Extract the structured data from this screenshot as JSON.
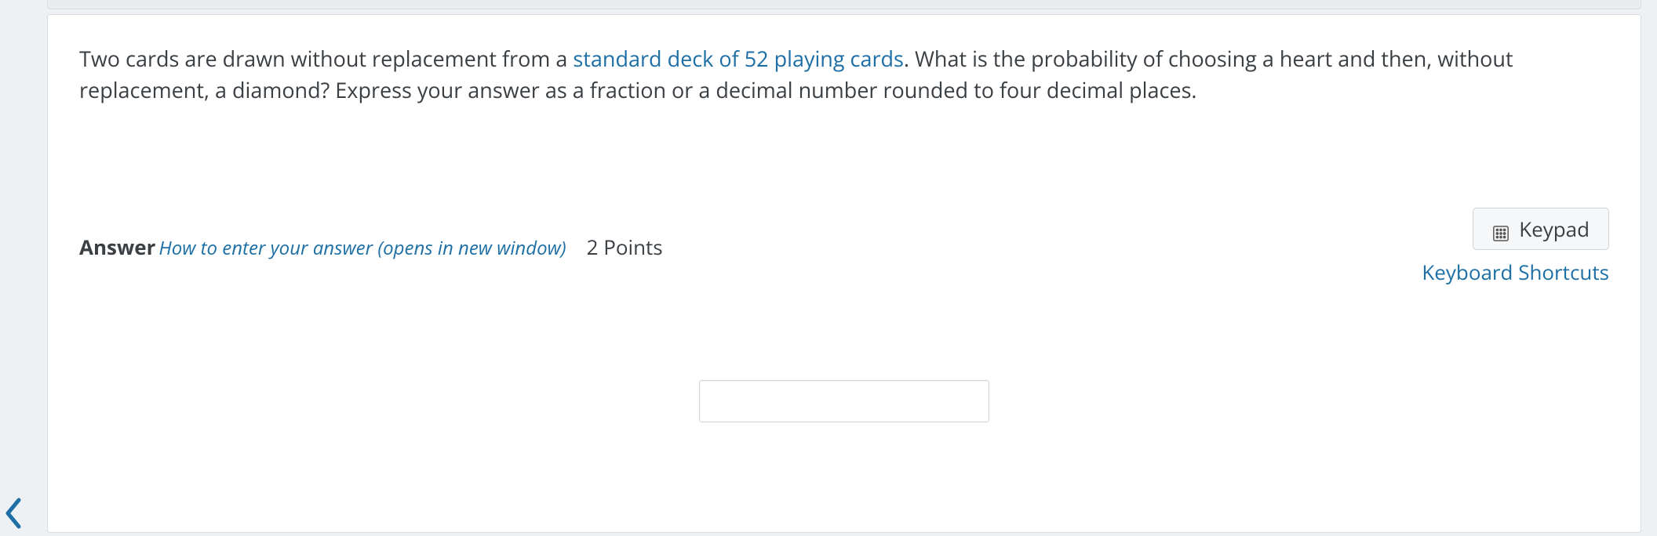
{
  "question": {
    "text_before_link": "Two cards are drawn without replacement from a ",
    "link_text": "standard deck of 52 playing cards",
    "text_after_link": ". What is the probability of choosing a heart and then, without replacement, a diamond? Express your answer as a fraction or a decimal number rounded to four decimal places."
  },
  "answer_section": {
    "label": "Answer",
    "help_text": "How to enter your answer (opens in new window)",
    "points_text": "2 Points"
  },
  "controls": {
    "keypad_label": "Keypad",
    "keyboard_shortcuts_label": "Keyboard Shortcuts"
  },
  "input": {
    "value": "",
    "placeholder": ""
  }
}
